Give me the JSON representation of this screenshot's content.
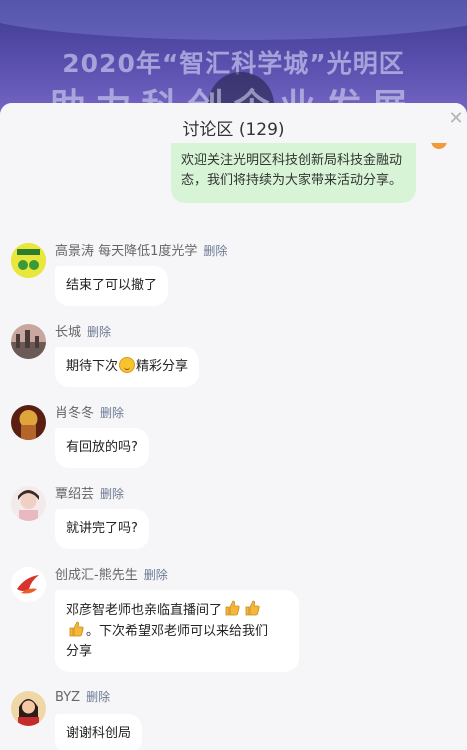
{
  "banner": {
    "title_line1": "2020年“智汇科学城”光明区",
    "title_line2": "助力科创企业发展"
  },
  "panel": {
    "title": "讨论区 (129)",
    "close_icon": "close-icon"
  },
  "own_message": {
    "text": "欢迎关注光明区科技创新局科技金融动态，我们将持续为大家带来活动分享。",
    "avatar_text": "💼"
  },
  "delete_label": "删除",
  "messages": [
    {
      "name": "高景涛 每天降低1度光学",
      "text": "结束了可以撤了"
    },
    {
      "name": "长城",
      "text_before": "期待下次",
      "emoji": "smile-emoji",
      "text_after": "精彩分享"
    },
    {
      "name": "肖冬冬",
      "text": "有回放的吗?"
    },
    {
      "name": "覃绍芸",
      "text": "就讲完了吗?"
    },
    {
      "name": "创成汇-熊先生",
      "text_line1": "邓彦智老师也亲临直播间了",
      "text_line2": "。下次希望邓老师可以来给我们",
      "text_line3": "分享"
    },
    {
      "name": "BYZ",
      "text": "谢谢科创局"
    }
  ],
  "colors": {
    "own_bubble": "#d8f4d6",
    "delete_link": "#6c7a93",
    "sheet_bg": "#f6f6f8"
  }
}
